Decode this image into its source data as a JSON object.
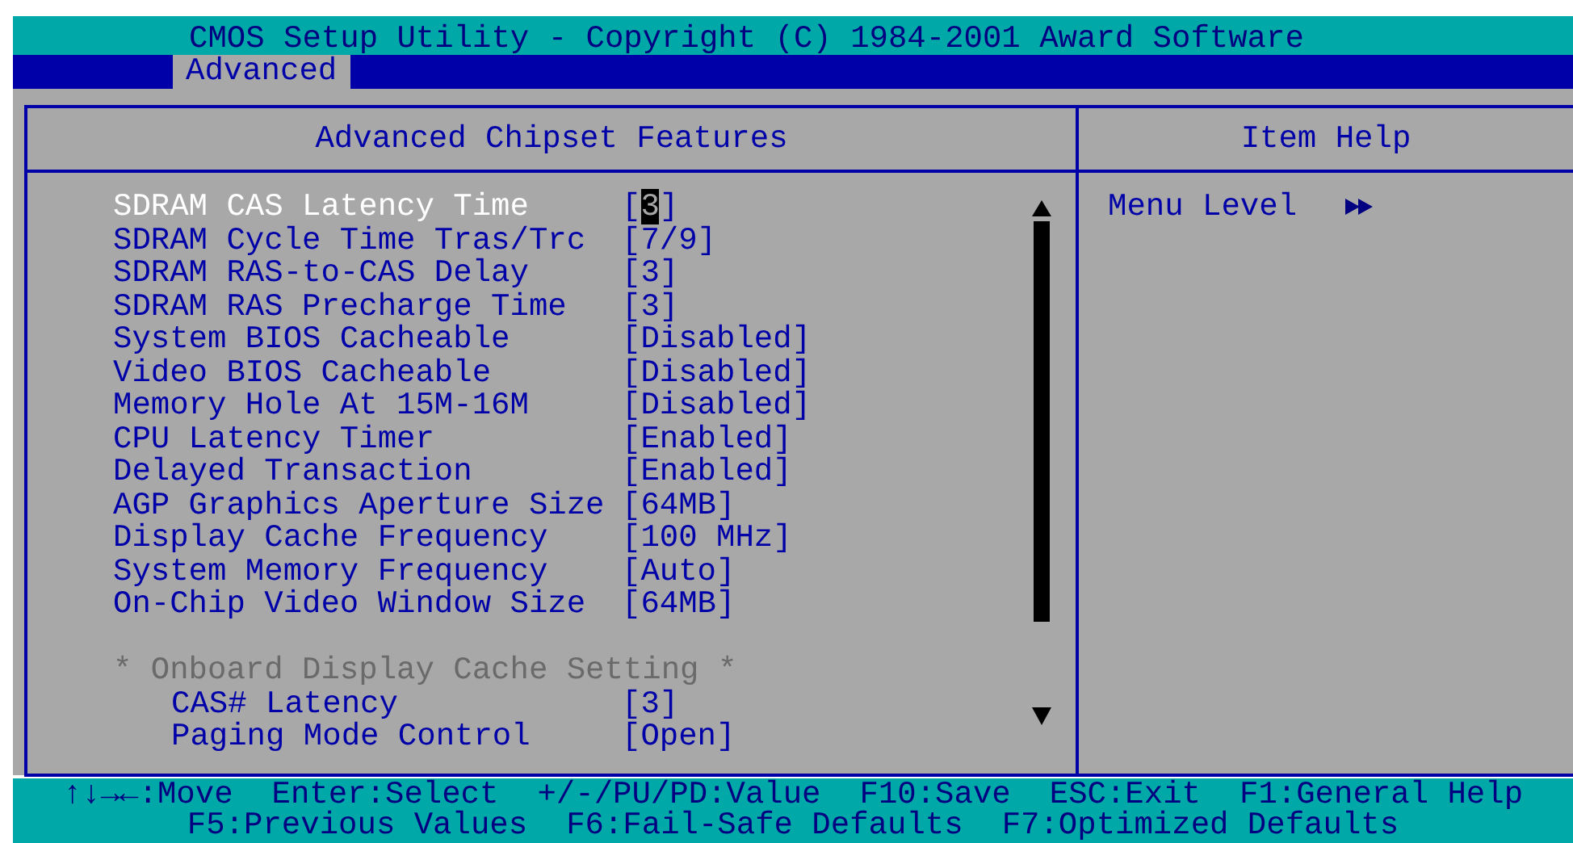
{
  "window": {
    "title": "CMOS Setup Utility - Copyright (C) 1984-2001 Award Software"
  },
  "menu": [
    {
      "label": "Advanced",
      "selected": true
    }
  ],
  "panel": {
    "title": "Advanced Chipset Features"
  },
  "items": [
    {
      "kind": "setting",
      "label": "SDRAM CAS Latency Time",
      "value": "[3]",
      "selected": true
    },
    {
      "kind": "setting",
      "label": "SDRAM Cycle Time Tras/Trc",
      "value": "[7/9]",
      "selected": false
    },
    {
      "kind": "setting",
      "label": "SDRAM RAS-to-CAS Delay",
      "value": "[3]",
      "selected": false
    },
    {
      "kind": "setting",
      "label": "SDRAM RAS Precharge Time",
      "value": "[3]",
      "selected": false
    },
    {
      "kind": "setting",
      "label": "System BIOS Cacheable",
      "value": "[Disabled]",
      "selected": false
    },
    {
      "kind": "setting",
      "label": "Video BIOS Cacheable",
      "value": "[Disabled]",
      "selected": false
    },
    {
      "kind": "setting",
      "label": "Memory Hole At 15M-16M",
      "value": "[Disabled]",
      "selected": false
    },
    {
      "kind": "setting",
      "label": "CPU Latency Timer",
      "value": "[Enabled]",
      "selected": false
    },
    {
      "kind": "setting",
      "label": "Delayed Transaction",
      "value": "[Enabled]",
      "selected": false
    },
    {
      "kind": "setting",
      "label": "AGP Graphics Aperture Size",
      "value": "[64MB]",
      "selected": false
    },
    {
      "kind": "setting",
      "label": "Display Cache Frequency",
      "value": "[100 MHz]",
      "selected": false
    },
    {
      "kind": "setting",
      "label": "System Memory Frequency",
      "value": "[Auto]",
      "selected": false
    },
    {
      "kind": "setting",
      "label": "On-Chip Video Window Size",
      "value": "[64MB]",
      "selected": false
    },
    {
      "kind": "heading",
      "label": "* Onboard Display Cache Setting *"
    },
    {
      "kind": "subsetting",
      "label": "CAS# Latency",
      "value": "[3]",
      "selected": false
    },
    {
      "kind": "subsetting",
      "label": "Paging Mode Control",
      "value": "[Open]",
      "selected": false
    }
  ],
  "help": {
    "title": "Item Help",
    "menu_level_label": "Menu Level"
  },
  "footer": [
    [
      "↑↓→←:Move",
      "Enter:Select",
      "+/-/PU/PD:Value",
      "F10:Save",
      "ESC:Exit",
      "F1:General Help"
    ],
    [
      "F5:Previous Values",
      "F6:Fail-Safe Defaults",
      "F7:Optimized Defaults"
    ]
  ]
}
